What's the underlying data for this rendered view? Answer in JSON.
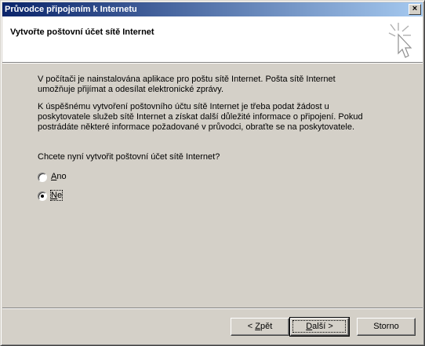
{
  "window": {
    "title": "Průvodce připojením k Internetu",
    "close_glyph": "×"
  },
  "header": {
    "title": "Vytvořte poštovní účet sítě Internet",
    "icon": "wizard-sparkle-cursor-icon"
  },
  "body": {
    "para1_line1": "V počítači je nainstalována aplikace pro poštu sítě Internet. Pošta sítě Internet",
    "para1_line2": "umožňuje přijímat a odesílat elektronické zprávy.",
    "para2_line1": "K úspěšnému vytvoření poštovního účtu sítě Internet je třeba podat žádost u",
    "para2_line2": "poskytovatele služeb sítě Internet a získat další důležité informace o připojení. Pokud",
    "para2_line3": "postrádáte některé informace požadované v průvodci, obraťte se na  poskytovatele.",
    "question": "Chcete nyní vytvořit poštovní účet sítě Internet?",
    "options": [
      {
        "first": "A",
        "rest": "no",
        "checked": false
      },
      {
        "first": "N",
        "rest": "e",
        "checked": true
      }
    ]
  },
  "buttons": {
    "back_prefix": "< ",
    "back_key": "Z",
    "back_rest": "pět",
    "next_key": "D",
    "next_rest": "alší >",
    "cancel": "Storno"
  }
}
